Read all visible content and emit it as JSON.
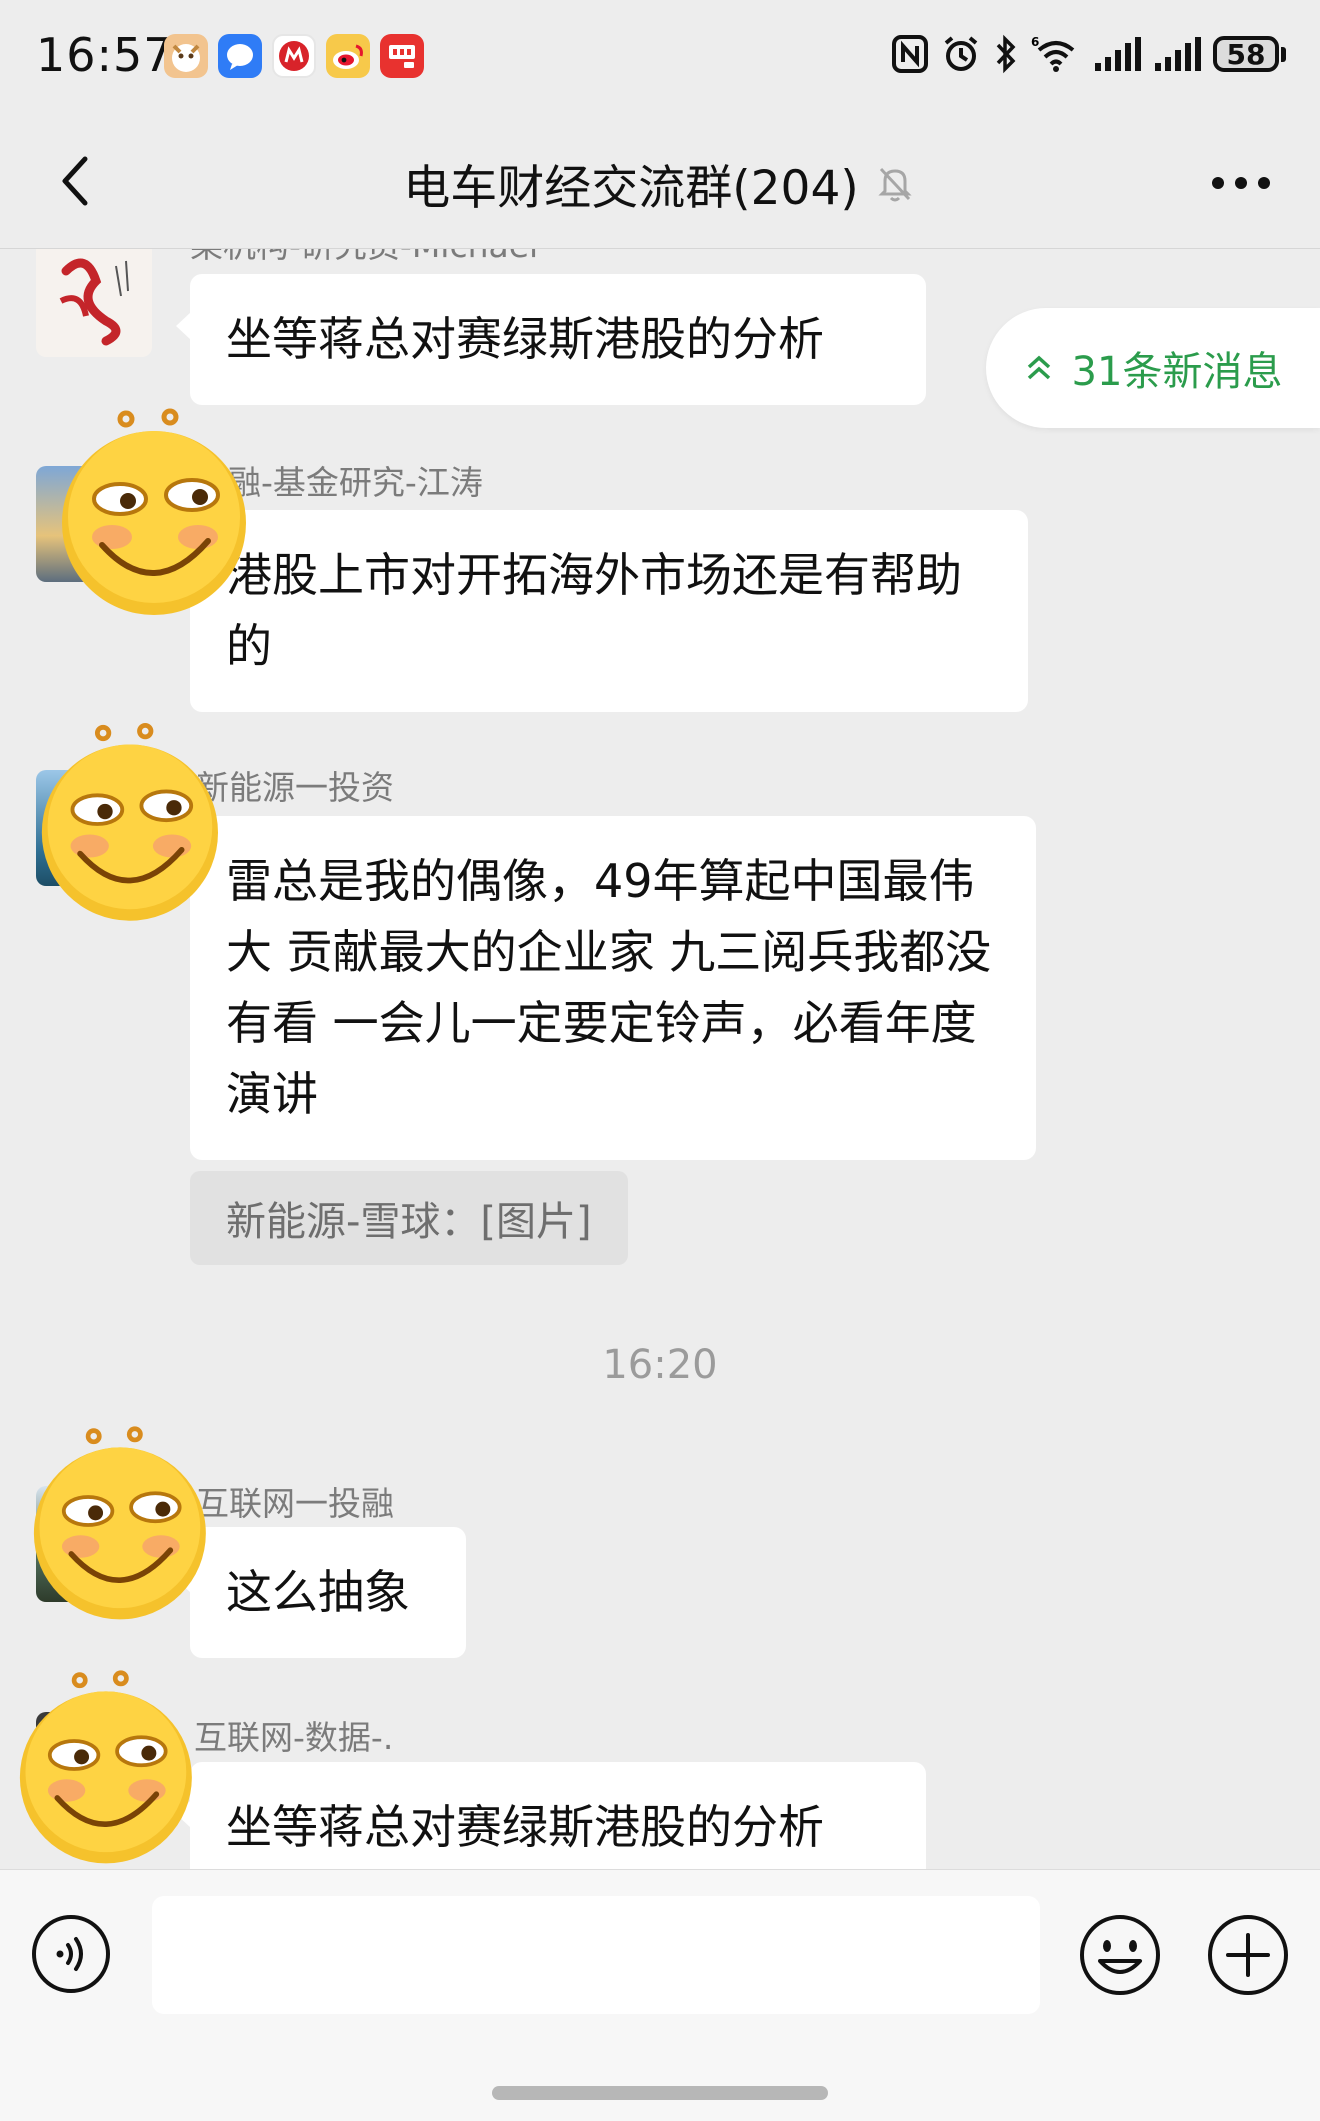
{
  "status_bar": {
    "time": "16:57",
    "app_icons": [
      "cat-app-icon",
      "chat-app-icon",
      "bank-app-icon",
      "weibo-icon",
      "news-app-icon"
    ],
    "system_icons": [
      "nfc-icon",
      "alarm-icon",
      "bluetooth-icon",
      "wifi-6-icon",
      "signal-icon",
      "signal-icon"
    ],
    "battery": "58"
  },
  "header": {
    "title": "电车财经交流群(204)",
    "muted": true
  },
  "new_messages": {
    "label": "31条新消息"
  },
  "messages": [
    {
      "sender": "某机构-研究员-Michael",
      "text": "坐等蒋总对赛绿斯港股的分析"
    },
    {
      "sender": "融-基金研究-江涛",
      "text": "港股上市对开拓海外市场还是有帮助的"
    },
    {
      "sender": "新能源一投资",
      "text": "雷总是我的偶像，49年算起中国最伟大 贡献最大的企业家  九三阅兵我都没有看   一会儿一定要定铃声，必看年度演讲"
    },
    {
      "quote": "新能源-雪球：[图片]"
    },
    {
      "timestamp": "16:20"
    },
    {
      "sender": "互联网一投融",
      "text": "这么抽象"
    },
    {
      "sender": "互联网-数据-.",
      "text": "坐等蒋总对赛绿斯港股的分析"
    }
  ],
  "input": {
    "placeholder": "",
    "value": ""
  },
  "colors": {
    "accent_green": "#2b9c4c",
    "background": "#ededed",
    "bubble": "#ffffff"
  }
}
